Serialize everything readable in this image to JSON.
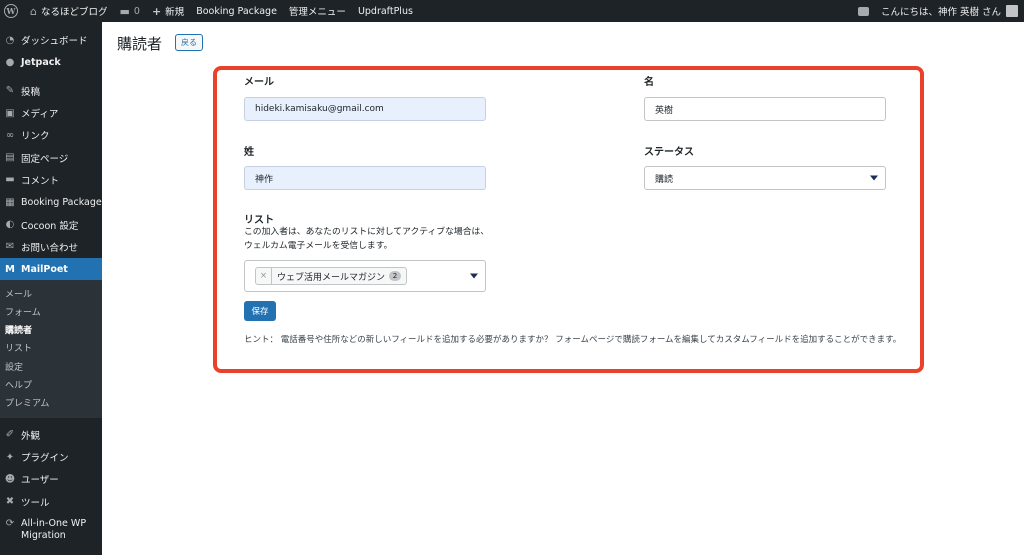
{
  "adminbar": {
    "site_name": "なるほどブログ",
    "comments_count": "0",
    "new_label": "新規",
    "booking_package": "Booking Package",
    "admin_menu": "管理メニュー",
    "updraftplus": "UpdraftPlus",
    "greeting": "こんにちは、神作 英樹 さん"
  },
  "sidebar": {
    "items": [
      {
        "label": "ダッシュボード",
        "icon": "dashboard-icon",
        "glyph": "◔"
      },
      {
        "label": "Jetpack",
        "icon": "jetpack-icon",
        "glyph": "●"
      },
      {
        "label": "投稿",
        "icon": "pin-icon",
        "glyph": "✎"
      },
      {
        "label": "メディア",
        "icon": "media-icon",
        "glyph": "▣"
      },
      {
        "label": "リンク",
        "icon": "link-icon",
        "glyph": "∞"
      },
      {
        "label": "固定ページ",
        "icon": "page-icon",
        "glyph": "▤"
      },
      {
        "label": "コメント",
        "icon": "comment-icon",
        "glyph": "▬"
      },
      {
        "label": "Booking Package",
        "icon": "calendar-icon",
        "glyph": "▦"
      },
      {
        "label": "Cocoon 設定",
        "icon": "cocoon-icon",
        "glyph": "◐"
      },
      {
        "label": "お問い合わせ",
        "icon": "mail-icon",
        "glyph": "✉"
      },
      {
        "label": "MailPoet",
        "icon": "mailpoet-icon",
        "glyph": "M"
      }
    ],
    "submenu": [
      "メール",
      "フォーム",
      "購読者",
      "リスト",
      "設定",
      "ヘルプ",
      "プレミアム"
    ],
    "bottom_items": [
      {
        "label": "外観",
        "icon": "appearance-icon",
        "glyph": "✐"
      },
      {
        "label": "プラグイン",
        "icon": "plugin-icon",
        "glyph": "✦"
      },
      {
        "label": "ユーザー",
        "icon": "user-icon",
        "glyph": "☻"
      },
      {
        "label": "ツール",
        "icon": "tool-icon",
        "glyph": "✖"
      },
      {
        "label": "All-in-One WP Migration",
        "icon": "migration-icon",
        "glyph": "⟳"
      }
    ]
  },
  "page": {
    "title": "購読者",
    "back_label": "戻る"
  },
  "form": {
    "email_label": "メール",
    "email_value": "hideki.kamisaku@gmail.com",
    "first_name_label": "名",
    "first_name_value": "英樹",
    "last_name_label": "姓",
    "last_name_value": "神作",
    "status_label": "ステータス",
    "status_value": "購読",
    "list_label": "リスト",
    "list_description": "この加入者は、あなたのリストに対してアクティブな場合は、ウェルカム電子メールを受信します。",
    "list_tag_remove": "×",
    "list_tag": "ウェブ活用メールマガジン",
    "list_tag_count": "2",
    "save_label": "保存",
    "hint": "ヒント： 電話番号や住所などの新しいフィールドを追加する必要がありますか？ フォームページで購読フォームを編集してカスタムフィールドを追加することができます。"
  },
  "colors": {
    "admin_dark": "#1d2327",
    "accent": "#2271b1",
    "highlight_border": "#e8432a"
  }
}
